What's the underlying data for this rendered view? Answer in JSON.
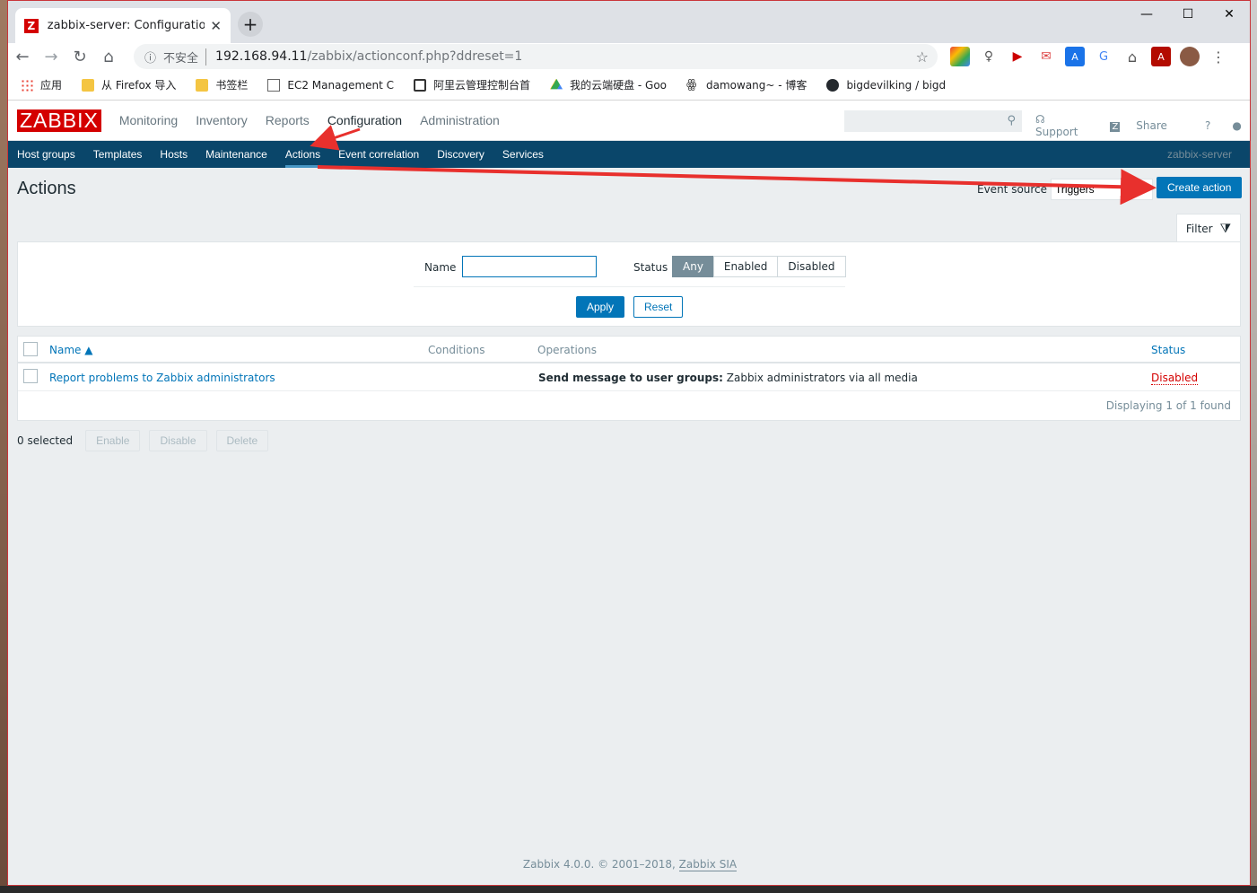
{
  "browser": {
    "tab_title": "zabbix-server: Configuration o",
    "url_host": "192.168.94.11",
    "url_path": "/zabbix/actionconf.php?ddreset=1",
    "security_label": "不安全",
    "bookmarks": [
      {
        "label": "应用"
      },
      {
        "label": "从 Firefox 导入"
      },
      {
        "label": "书签栏"
      },
      {
        "label": "EC2 Management C"
      },
      {
        "label": "阿里云管理控制台首"
      },
      {
        "label": "我的云端硬盘 - Goo"
      },
      {
        "label": "damowang~ - 博客"
      },
      {
        "label": "bigdevilking / bigd"
      }
    ]
  },
  "zabbix": {
    "logo": "ZABBIX",
    "top_menu": [
      "Monitoring",
      "Inventory",
      "Reports",
      "Configuration",
      "Administration"
    ],
    "header_links": {
      "support": "Support",
      "share": "Share",
      "help": "?"
    },
    "sub_menu": [
      "Host groups",
      "Templates",
      "Hosts",
      "Maintenance",
      "Actions",
      "Event correlation",
      "Discovery",
      "Services"
    ],
    "server_name": "zabbix-server",
    "page_title": "Actions",
    "event_source_label": "Event source",
    "event_source_value": "Triggers",
    "create_button": "Create action",
    "filter": {
      "tab_label": "Filter",
      "name_label": "Name",
      "name_value": "",
      "status_label": "Status",
      "status_options": [
        "Any",
        "Enabled",
        "Disabled"
      ],
      "status_selected": "Any",
      "apply": "Apply",
      "reset": "Reset"
    },
    "table": {
      "columns": [
        "Name ▲",
        "Conditions",
        "Operations",
        "Status"
      ],
      "rows": [
        {
          "name": "Report problems to Zabbix administrators",
          "conditions": "",
          "operations_bold": "Send message to user groups:",
          "operations_rest": " Zabbix administrators via all media",
          "status": "Disabled"
        }
      ],
      "footer": "Displaying 1 of 1 found"
    },
    "bulk": {
      "selected": "0 selected",
      "enable": "Enable",
      "disable": "Disable",
      "delete": "Delete"
    },
    "footer_text": "Zabbix 4.0.0. © 2001–2018,",
    "footer_link": "Zabbix SIA"
  },
  "colors": {
    "zabbix_red": "#d40000",
    "nav_blue": "#0a466a",
    "link_blue": "#0275b8",
    "annotation_red": "#e8302d"
  }
}
